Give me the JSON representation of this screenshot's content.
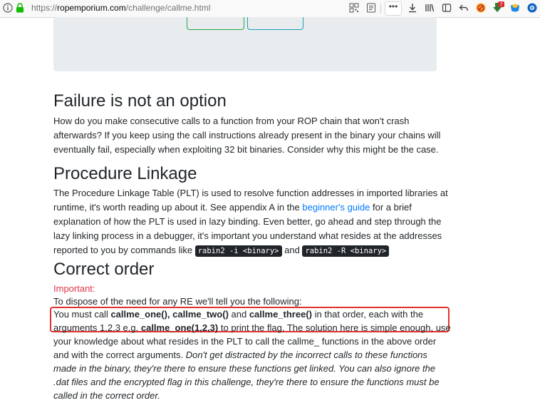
{
  "browser": {
    "url_prefix": "https://",
    "url_domain": "ropemporium.com",
    "url_path": "/challenge/callme.html",
    "dots": "•••",
    "badge_count": "7"
  },
  "sections": {
    "failure": {
      "heading": "Failure is not an option",
      "lines": [
        "How do you make consecutive calls to a function from your ROP chain that won't crash",
        "afterwards? If you keep using the call instructions already present in the binary your chains will",
        "eventually fail, especially when exploiting 32 bit binaries. Consider why this might be the case."
      ]
    },
    "plt": {
      "heading": "Procedure Linkage",
      "line1": "The Procedure Linkage Table (PLT) is used to resolve function addresses in imported libraries at",
      "line2_pre": "runtime, it's worth reading up about it. See appendix A in the ",
      "line2_link": "beginner's guide",
      "line2_post": " for a brief",
      "line3": "explanation of how the PLT is used in lazy binding. Even better, go ahead and step through the",
      "line4": "lazy linking process in a debugger, it's important you understand what resides at the addresses",
      "line5_pre": "reported to you by commands like ",
      "code1": "rabin2 -i <binary>",
      "line5_mid": " and ",
      "code2": "rabin2 -R <binary>"
    },
    "order": {
      "heading": "Correct order",
      "important": "Important:",
      "dispose": "To dispose of the need for any RE we'll tell you the following:",
      "l1_a": "You must call ",
      "l1_b": "callme_one(), callme_two()",
      "l1_c": " and ",
      "l1_d": "callme_three()",
      "l1_e": " in that order, each with the",
      "l2_a": "arguments 1,2,3 e.g. ",
      "l2_b": "callme_one(1,2,3)",
      "l2_c": " to print the flag. The solution here is simple enough, use",
      "l3": "your knowledge about what resides in the PLT to call the callme_ functions in the above order",
      "l4_a": "and with the correct arguments. ",
      "l4_b": "Don't get distracted by the incorrect calls to these functions",
      "l5": "made in the binary, they're there to ensure these functions get linked. You can also ignore the",
      "l6": ".dat files and the encrypted flag in this challenge, they're there to ensure the functions must be",
      "l7": "called in the correct order."
    }
  }
}
